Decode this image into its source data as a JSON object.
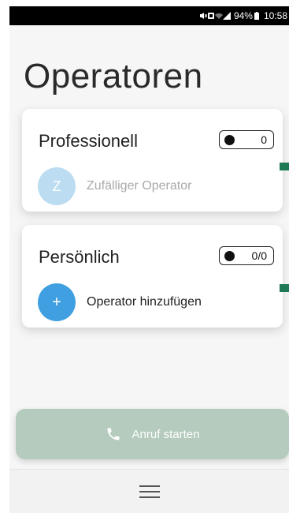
{
  "status_bar": {
    "battery": "94%",
    "time": "10:58"
  },
  "page_title": "Operatoren",
  "cards": {
    "professionell": {
      "title": "Professionell",
      "counter": "0",
      "operator": {
        "avatar_letter": "Z",
        "label": "Zufälliger Operator"
      }
    },
    "persoenlich": {
      "title": "Persönlich",
      "counter": "0/0",
      "operator": {
        "avatar_letter": "+",
        "label": "Operator hinzufügen"
      }
    }
  },
  "call_button": {
    "label": "Anruf starten",
    "icon": "phone-icon"
  },
  "bottom_nav": {
    "icon": "menu-icon"
  },
  "colors": {
    "accent_blue": "#3f9fe0",
    "muted_blue": "#bcdcf1",
    "call_button": "#b4cbbe",
    "side_tab": "#1e7a55"
  }
}
